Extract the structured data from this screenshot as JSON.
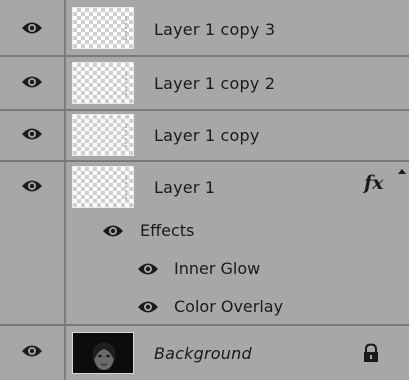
{
  "layers": [
    {
      "name": "Layer 1 copy 3"
    },
    {
      "name": "Layer 1 copy 2"
    },
    {
      "name": "Layer 1 copy"
    },
    {
      "name": "Layer 1",
      "badge": "fx"
    }
  ],
  "effects": {
    "label": "Effects",
    "items": [
      "Inner Glow",
      "Color Overlay"
    ]
  },
  "background": {
    "name": "Background",
    "locked": true
  },
  "icons": {
    "visibility": "eye-icon",
    "lock": "lock-icon",
    "effects_badge": "fx-icon"
  }
}
